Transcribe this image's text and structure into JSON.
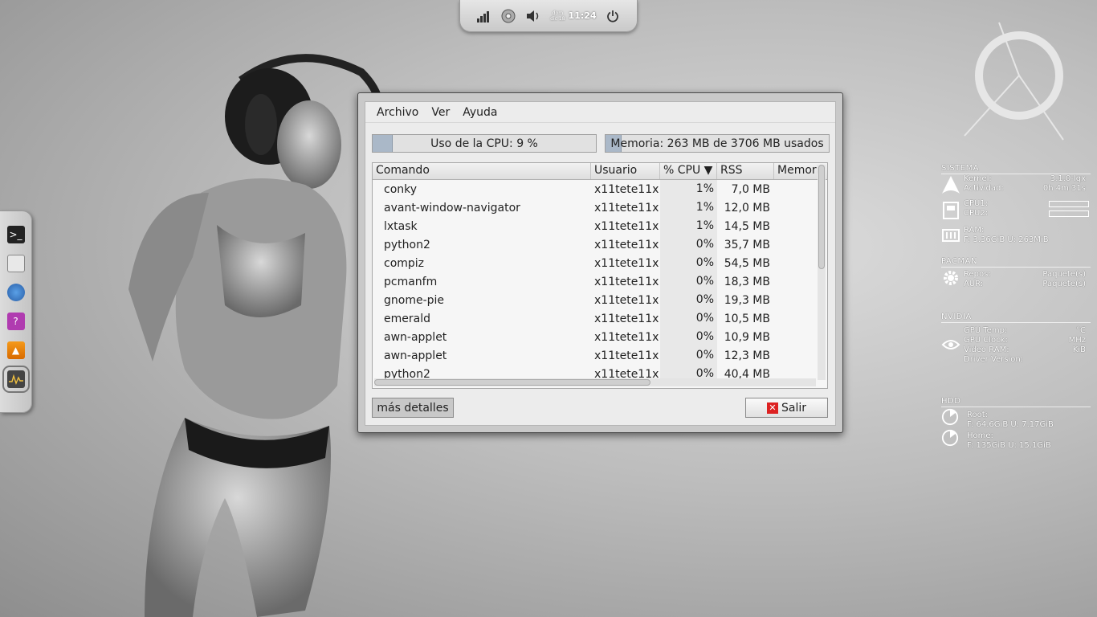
{
  "top_panel": {
    "date_line1": "dom",
    "date_line2": "dic 18",
    "time": "11:24"
  },
  "window": {
    "menu": [
      "Archivo",
      "Ver",
      "Ayuda"
    ],
    "cpu_bar": {
      "label": "Uso de la CPU: 9 %",
      "fraction": 0.09
    },
    "mem_bar": {
      "label": "Memoria: 263 MB de 3706 MB usados",
      "fraction": 0.071
    },
    "columns": [
      "Comando",
      "Usuario",
      "% CPU ▼",
      "RSS",
      "Memori"
    ],
    "rows": [
      {
        "cmd": "conky",
        "user": "x11tete11x",
        "cpu": "1%",
        "rss": "7,0 MB"
      },
      {
        "cmd": "avant-window-navigator",
        "user": "x11tete11x",
        "cpu": "1%",
        "rss": "12,0 MB"
      },
      {
        "cmd": "lxtask",
        "user": "x11tete11x",
        "cpu": "1%",
        "rss": "14,5 MB"
      },
      {
        "cmd": "python2",
        "user": "x11tete11x",
        "cpu": "0%",
        "rss": "35,7 MB"
      },
      {
        "cmd": "compiz",
        "user": "x11tete11x",
        "cpu": "0%",
        "rss": "54,5 MB"
      },
      {
        "cmd": "pcmanfm",
        "user": "x11tete11x",
        "cpu": "0%",
        "rss": "18,3 MB"
      },
      {
        "cmd": "gnome-pie",
        "user": "x11tete11x",
        "cpu": "0%",
        "rss": "19,3 MB"
      },
      {
        "cmd": "emerald",
        "user": "x11tete11x",
        "cpu": "0%",
        "rss": "10,5 MB"
      },
      {
        "cmd": "awn-applet",
        "user": "x11tete11x",
        "cpu": "0%",
        "rss": "10,9 MB"
      },
      {
        "cmd": "awn-applet",
        "user": "x11tete11x",
        "cpu": "0%",
        "rss": "12,3 MB"
      },
      {
        "cmd": "python2",
        "user": "x11tete11x",
        "cpu": "0%",
        "rss": "40,4 MB"
      }
    ],
    "details_button": "más detalles",
    "quit_button": "Salir"
  },
  "conky": {
    "sistema": {
      "title": "SISTEMA",
      "kernel_label": "Kernel:",
      "kernel_value": "3.1.0-lqx",
      "uptime_label": "Actividad:",
      "uptime_value": "0h 4m 31s",
      "cpu1_label": "CPU1:",
      "cpu2_label": "CPU2:",
      "ram_label": "RAM:",
      "ram_detail": "F: 3.36GiB U: 263MiB"
    },
    "pacman": {
      "title": "PACMAN",
      "repos_label": "Repos:",
      "aur_label": "AUR:",
      "pkg_unit": "Paquete(s)"
    },
    "nvidia": {
      "title": "NVIDIA",
      "gpu_temp_label": "GPU Temp:",
      "gpu_temp_unit": "°C",
      "gpu_clock_label": "GPU Clock:",
      "gpu_clock_unit": "MHz",
      "vram_label": "Video RAM:",
      "vram_unit": "KiB",
      "driver_label": "Driver Version:"
    },
    "hdd": {
      "title": "HDD",
      "root_label": "Root:",
      "root_detail": "F: 64.6GiB U: 7.17GiB",
      "home_label": "Home:",
      "home_detail": "F: 135GiB U: 15.1GiB"
    }
  }
}
